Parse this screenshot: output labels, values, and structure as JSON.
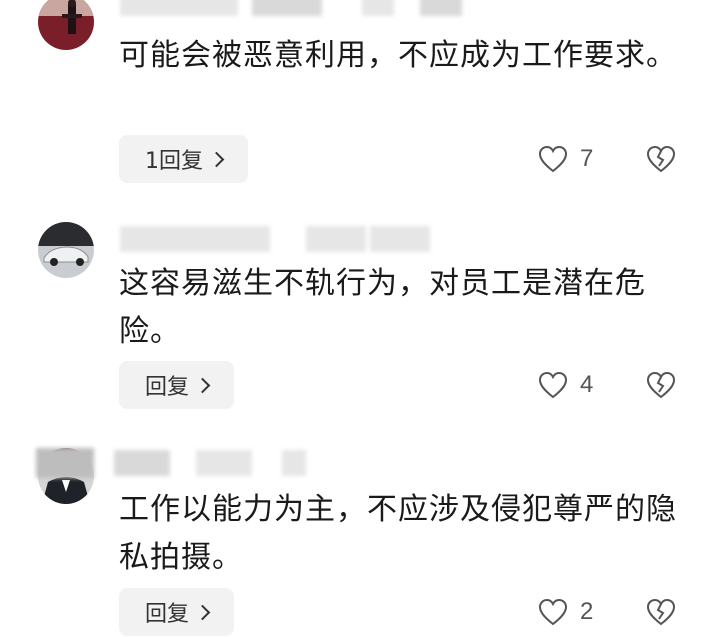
{
  "comments": [
    {
      "text": "可能会被恶意利用，不应成为工作要求。",
      "reply_label": "1回复",
      "likes": "7",
      "avatar": "person-photo"
    },
    {
      "text": "这容易滋生不轨行为，对员工是潜在危险。",
      "reply_label": "回复",
      "likes": "4",
      "avatar": "car-photo"
    },
    {
      "text": "工作以能力为主，不应涉及侵犯尊严的隐私拍摄。",
      "reply_label": "回复",
      "likes": "2",
      "avatar": "person-suit-photo"
    }
  ],
  "icons": {
    "like": "heart-outline-icon",
    "dislike": "broken-heart-icon",
    "reply_chevron": "chevron-right-icon"
  }
}
